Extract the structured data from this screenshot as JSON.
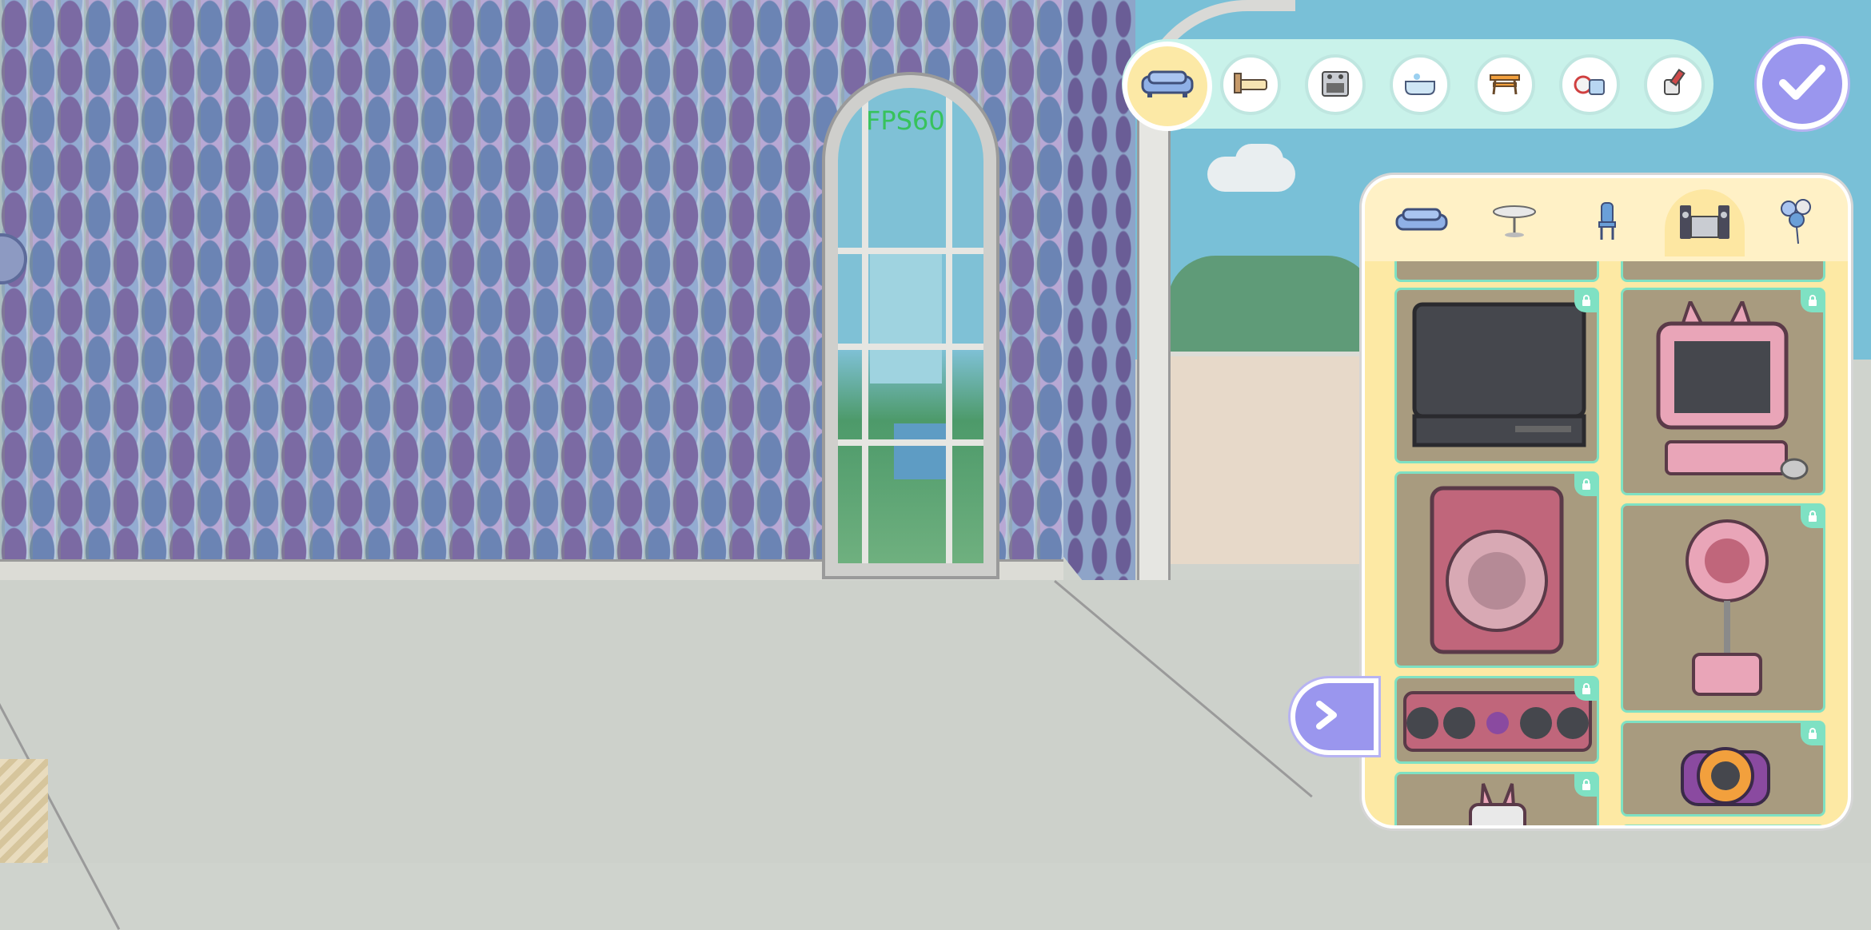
{
  "hud": {
    "fps_text": "FPS60"
  },
  "top_categories": [
    {
      "icon": "sofa-icon",
      "selected": true
    },
    {
      "icon": "bed-icon",
      "selected": false
    },
    {
      "icon": "stove-icon",
      "selected": false
    },
    {
      "icon": "bathtub-icon",
      "selected": false
    },
    {
      "icon": "table-bench-icon",
      "selected": false
    },
    {
      "icon": "toys-icon",
      "selected": false
    },
    {
      "icon": "paint-bucket-icon",
      "selected": false
    }
  ],
  "confirm_button": {
    "icon": "checkmark-icon"
  },
  "panel": {
    "tabs": [
      {
        "icon": "sofa-icon",
        "selected": false
      },
      {
        "icon": "round-table-icon",
        "selected": false
      },
      {
        "icon": "chair-icon",
        "selected": false
      },
      {
        "icon": "stereo-icon",
        "selected": true
      },
      {
        "icon": "balloons-icon",
        "selected": false
      }
    ],
    "items": [
      {
        "icon": "tv-icon",
        "locked": true
      },
      {
        "icon": "bunny-computer-icon",
        "locked": true
      },
      {
        "icon": "speaker-icon",
        "locked": true
      },
      {
        "icon": "microphone-stand-icon",
        "locked": true
      },
      {
        "icon": "soundbar-icon",
        "locked": true
      },
      {
        "icon": "flower-camera-icon",
        "locked": true
      },
      {
        "icon": "bunny-device-icon",
        "locked": true
      }
    ]
  },
  "colors": {
    "accent": "#9a96ee",
    "panel_bg": "#fde9a4",
    "lock": "#7fe1c3",
    "catbar": "#c9f2ea"
  }
}
